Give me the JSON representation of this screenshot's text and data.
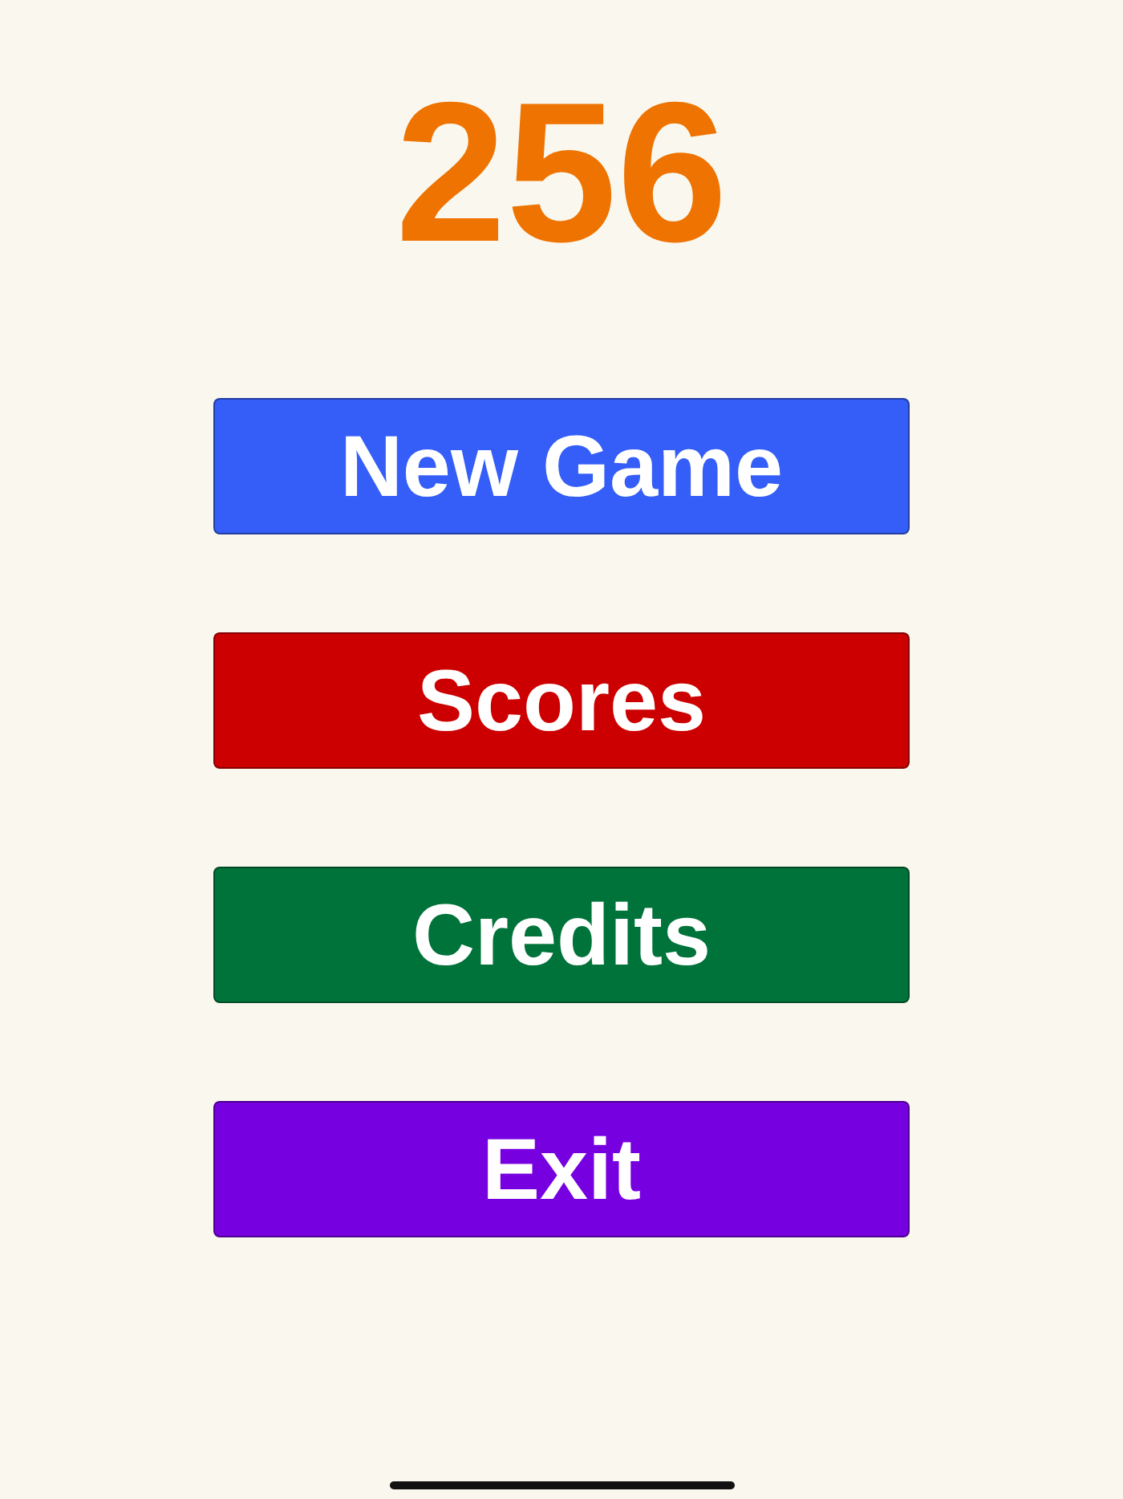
{
  "title": "256",
  "menu": [
    {
      "label": "New Game",
      "color": "#345ef7"
    },
    {
      "label": "Scores",
      "color": "#cc0000"
    },
    {
      "label": "Credits",
      "color": "#00733a"
    },
    {
      "label": "Exit",
      "color": "#7700e0"
    }
  ]
}
